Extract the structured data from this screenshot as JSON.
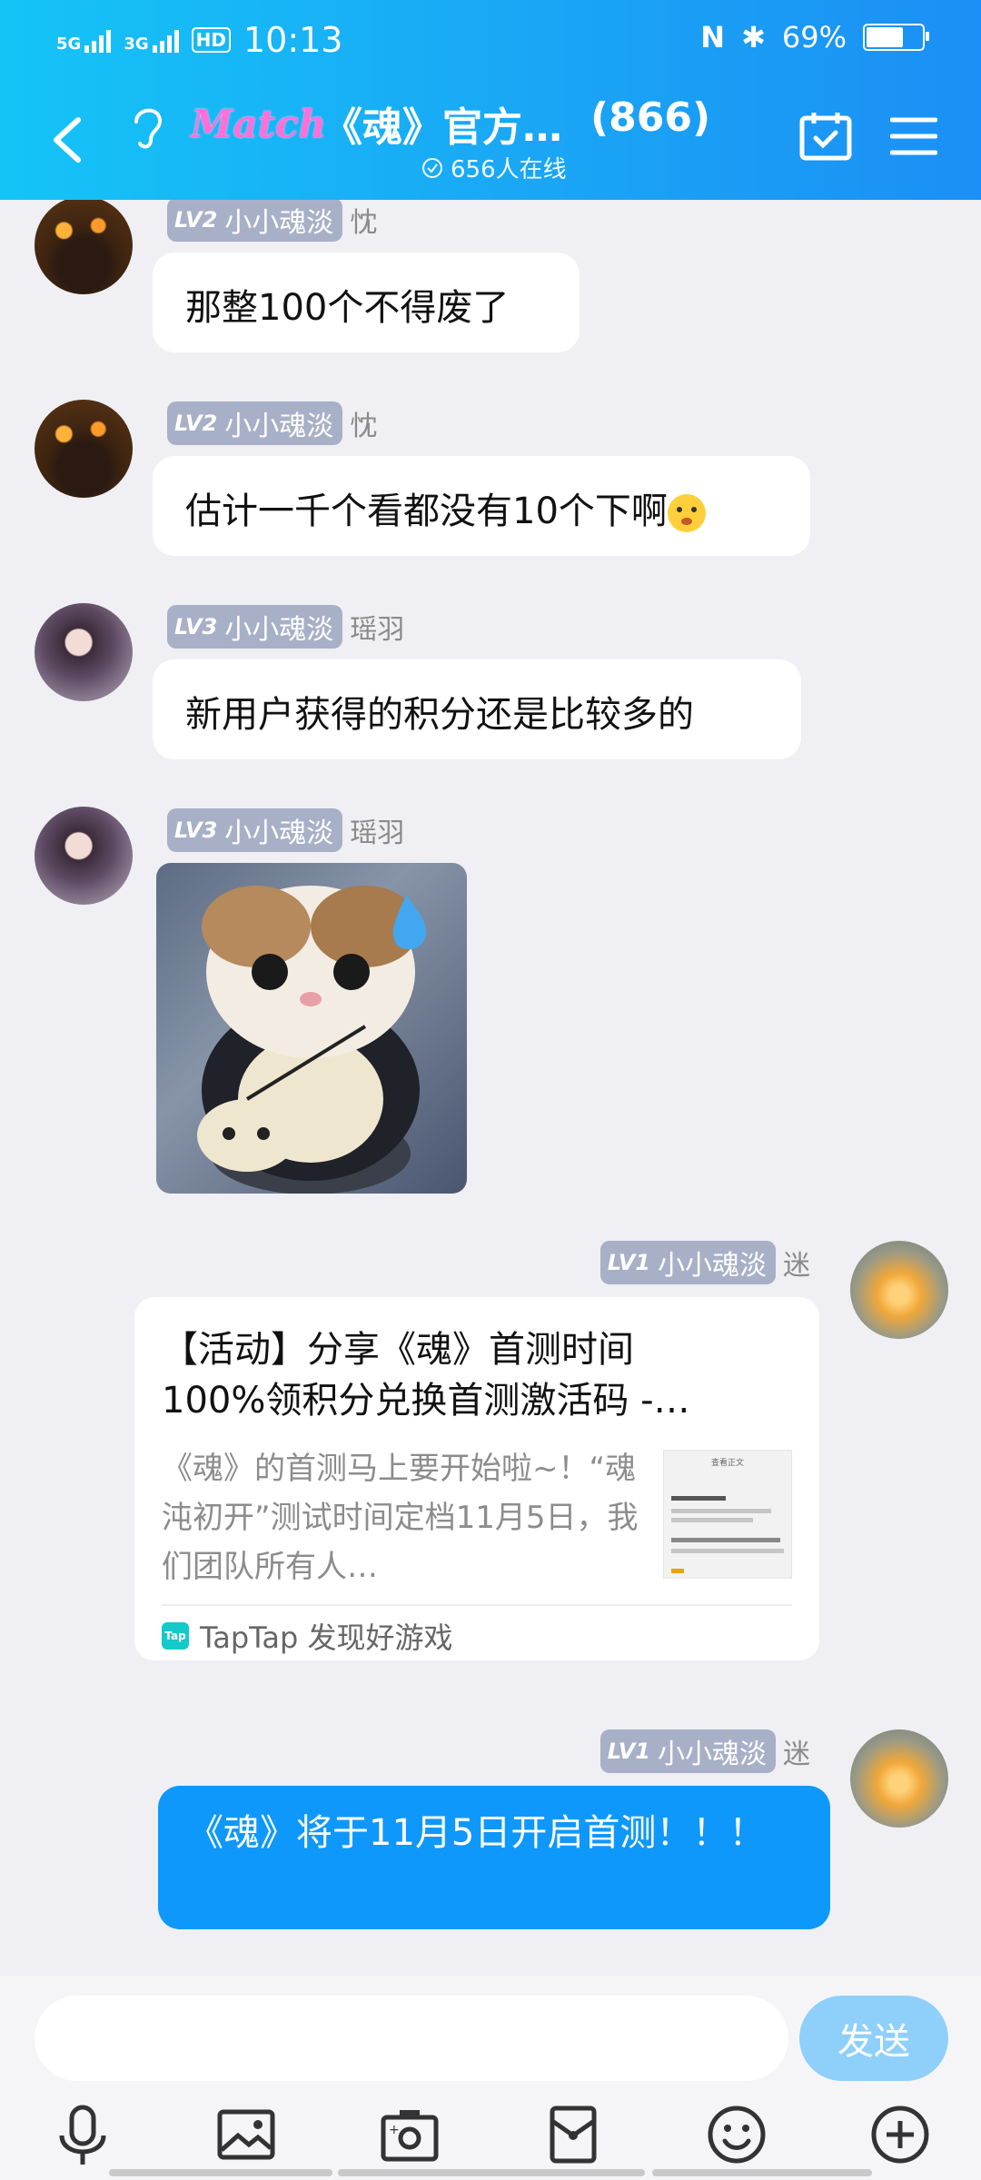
{
  "status": {
    "net1": "5G",
    "net2": "3G",
    "hd": "HD",
    "time": "10:13",
    "battery_pct": "69%",
    "battery_level": 0.69
  },
  "header": {
    "logo_text": "Match",
    "group_title": "《魂》官方…",
    "member_count": "(866)",
    "online_text": "656人在线"
  },
  "messages": [
    {
      "level": "LV2",
      "rank": "小小魂淡",
      "name": "忱",
      "text": "那整100个不得废了"
    },
    {
      "level": "LV2",
      "rank": "小小魂淡",
      "name": "忱",
      "text": "估计一千个看都没有10个下啊"
    },
    {
      "level": "LV3",
      "rank": "小小魂淡",
      "name": "瑶羽",
      "text": "新用户获得的积分还是比较多的"
    },
    {
      "level": "LV3",
      "rank": "小小魂淡",
      "name": "瑶羽"
    },
    {
      "level": "LV1",
      "rank": "小小魂淡",
      "name": "迷"
    },
    {
      "level": "LV1",
      "rank": "小小魂淡",
      "name": "迷",
      "text": "《魂》将于11月5日开启首测！！！"
    }
  ],
  "card": {
    "title_line1": "【活动】分享《魂》首测时间",
    "title_line2": "100%领积分兑换首测激活码 -…",
    "desc": "《魂》的首测马上要开始啦~！“魂沌初开”测试时间定档11月5日，我们团队所有人…",
    "thumb_title": "查看正文",
    "source": "TapTap 发现好游戏",
    "source_icon": "Tap"
  },
  "input": {
    "placeholder": "",
    "send_label": "发送"
  },
  "toolbar_icons": [
    "microphone-icon",
    "image-icon",
    "camera-icon",
    "red-packet-icon",
    "emoji-icon",
    "plus-icon"
  ]
}
